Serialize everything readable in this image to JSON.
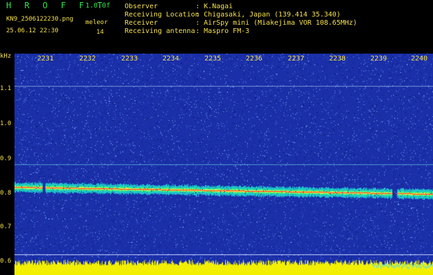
{
  "header": {
    "app_title": "H R O F F T",
    "version": "1.0.0f",
    "filename": "KN9_2506122230.png",
    "meleor_label": "meleor",
    "date": "25.06.12 22:30",
    "count": "14",
    "info": [
      {
        "label": "Observer",
        "value": ": K.Nagai"
      },
      {
        "label": "Receiving Location",
        "value": ": Chigasaki, Japan (139.414 35.340)"
      },
      {
        "label": "Receiver",
        "value": ": AirSpy mini (Miakejima VOR 108.65MHz)"
      },
      {
        "label": "Receiving antenna",
        "value": ": Maspro FM-3"
      }
    ]
  },
  "spectrogram": {
    "y_unit": "kHz",
    "y_ticks": [
      "1.1",
      "1.0",
      "0.9",
      "0.8",
      "0.7",
      "0.6"
    ],
    "x_ticks": [
      "2231",
      "2232",
      "2233",
      "2234",
      "2235",
      "2236",
      "2237",
      "2238",
      "2239",
      "2240"
    ],
    "colors": {
      "background": "#1a2fa8",
      "labels": "#f5e04a",
      "signal": "#ff3b2a",
      "floor": "#f2f000"
    }
  }
}
